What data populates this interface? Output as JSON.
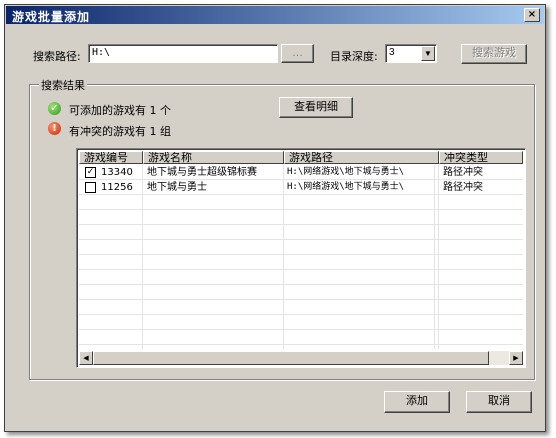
{
  "window": {
    "title": "游戏批量添加",
    "close_label": "×"
  },
  "search": {
    "path_label": "搜索路径:",
    "path_value": "H:\\",
    "browse_label": "...",
    "depth_label": "目录深度:",
    "depth_value": "3",
    "search_button": "搜索游戏"
  },
  "results": {
    "group_title": "搜索结果",
    "ok_text": "可添加的游戏有 1 个",
    "conflict_text": "有冲突的游戏有 1 组",
    "detail_button": "查看明细",
    "columns": [
      "游戏编号",
      "游戏名称",
      "游戏路径",
      "冲突类型"
    ],
    "rows": [
      {
        "checked": true,
        "check_mark": "✓",
        "id": "13340",
        "name": "地下城与勇士超级锦标赛",
        "path": "H:\\网络游戏\\地下城与勇士\\",
        "conflict": "路径冲突"
      },
      {
        "checked": false,
        "check_mark": "",
        "id": "11256",
        "name": "地下城与勇士",
        "path": "H:\\网络游戏\\地下城与勇士\\",
        "conflict": "路径冲突"
      }
    ]
  },
  "footer": {
    "add_button": "添加",
    "cancel_button": "取消"
  },
  "icons": {
    "ok": "check-circle-icon",
    "conflict": "exclamation-circle-icon"
  },
  "colors": {
    "title_start": "#0a246a",
    "title_end": "#a6caf0",
    "face": "#d4d0c8",
    "ok": "#2f9a17",
    "error": "#d02800"
  }
}
